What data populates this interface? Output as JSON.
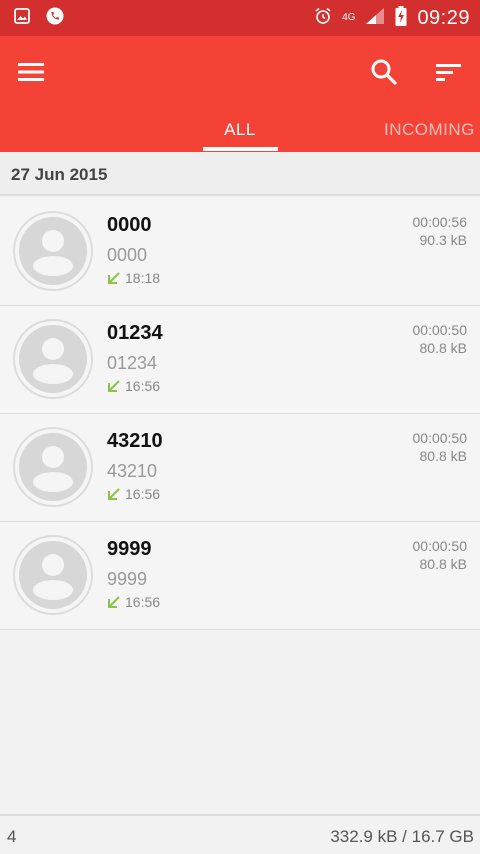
{
  "status_bar": {
    "time": "09:29",
    "network": "4G",
    "icons": [
      "gallery-icon",
      "call-recorder-icon",
      "alarm-icon",
      "signal-icon",
      "battery-charging-icon"
    ]
  },
  "app_bar": {
    "icons": [
      "menu-icon",
      "search-icon",
      "sort-icon"
    ],
    "tabs": [
      {
        "label": "ALL",
        "selected": true
      },
      {
        "label": "INCOMING",
        "selected": false
      }
    ]
  },
  "date_header": "27 Jun 2015",
  "recordings": [
    {
      "name": "0000",
      "number": "0000",
      "time": "18:18",
      "duration": "00:00:56",
      "size": "90.3 kB",
      "direction": "incoming"
    },
    {
      "name": "01234",
      "number": "01234",
      "time": "16:56",
      "duration": "00:00:50",
      "size": "80.8 kB",
      "direction": "incoming"
    },
    {
      "name": "43210",
      "number": "43210",
      "time": "16:56",
      "duration": "00:00:50",
      "size": "80.8 kB",
      "direction": "incoming"
    },
    {
      "name": "9999",
      "number": "9999",
      "time": "16:56",
      "duration": "00:00:50",
      "size": "80.8 kB",
      "direction": "incoming"
    }
  ],
  "footer": {
    "count": "4",
    "storage": "332.9 kB / 16.7 GB"
  },
  "colors": {
    "status_bar": "#d32f2f",
    "app_bar": "#f44336",
    "incoming_arrow": "#8bc34a"
  }
}
